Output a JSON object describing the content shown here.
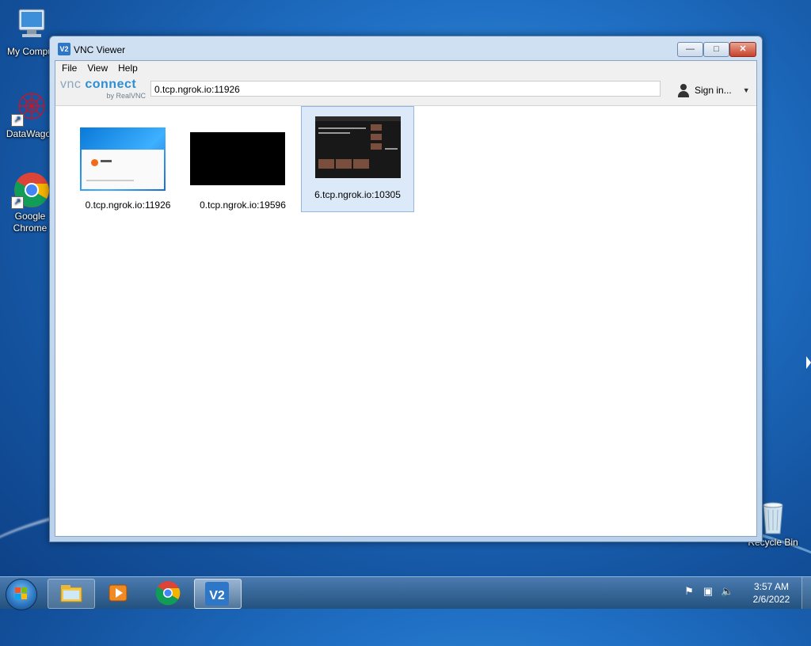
{
  "desktop": {
    "icons": [
      {
        "label": "My Compu",
        "icon": "computer-icon"
      },
      {
        "label": "DataWagor",
        "icon": "datawagon-icon"
      },
      {
        "label": "Google Chrome",
        "icon": "chrome-icon"
      },
      {
        "label": "Recycle Bin",
        "icon": "recycle-bin-icon"
      }
    ]
  },
  "window": {
    "title": "VNC Viewer",
    "icon_text": "V2",
    "controls": {
      "minimize": "—",
      "maximize": "□",
      "close": "✕"
    }
  },
  "menu": {
    "file": "File",
    "view": "View",
    "help": "Help"
  },
  "toolbar": {
    "logo_vnc": "vnc",
    "logo_connect": "connect",
    "logo_by": "by RealVNC",
    "address_value": "0.tcp.ngrok.io:11926",
    "signin_label": "Sign in...",
    "signin_caret": "▼"
  },
  "connections": [
    {
      "label": "0.tcp.ngrok.io:11926",
      "thumbnail": "windows-desktop",
      "selected": false
    },
    {
      "label": "0.tcp.ngrok.io:19596",
      "thumbnail": "black-screen",
      "selected": false
    },
    {
      "label": "6.tcp.ngrok.io:10305",
      "thumbnail": "dark-video-site",
      "selected": true
    }
  ],
  "taskbar": {
    "items": [
      "windows-explorer-icon",
      "media-player-icon",
      "chrome-icon",
      "vnc-viewer-icon"
    ],
    "active": "vnc-viewer-icon",
    "tray": [
      "action-center-flag-icon",
      "network-icon",
      "volume-icon"
    ],
    "time": "3:57 AM",
    "date": "2/6/2022"
  },
  "colors": {
    "accent": "#2b8fd6",
    "selection": "#dce9f9",
    "close_button": "#c7412a"
  }
}
